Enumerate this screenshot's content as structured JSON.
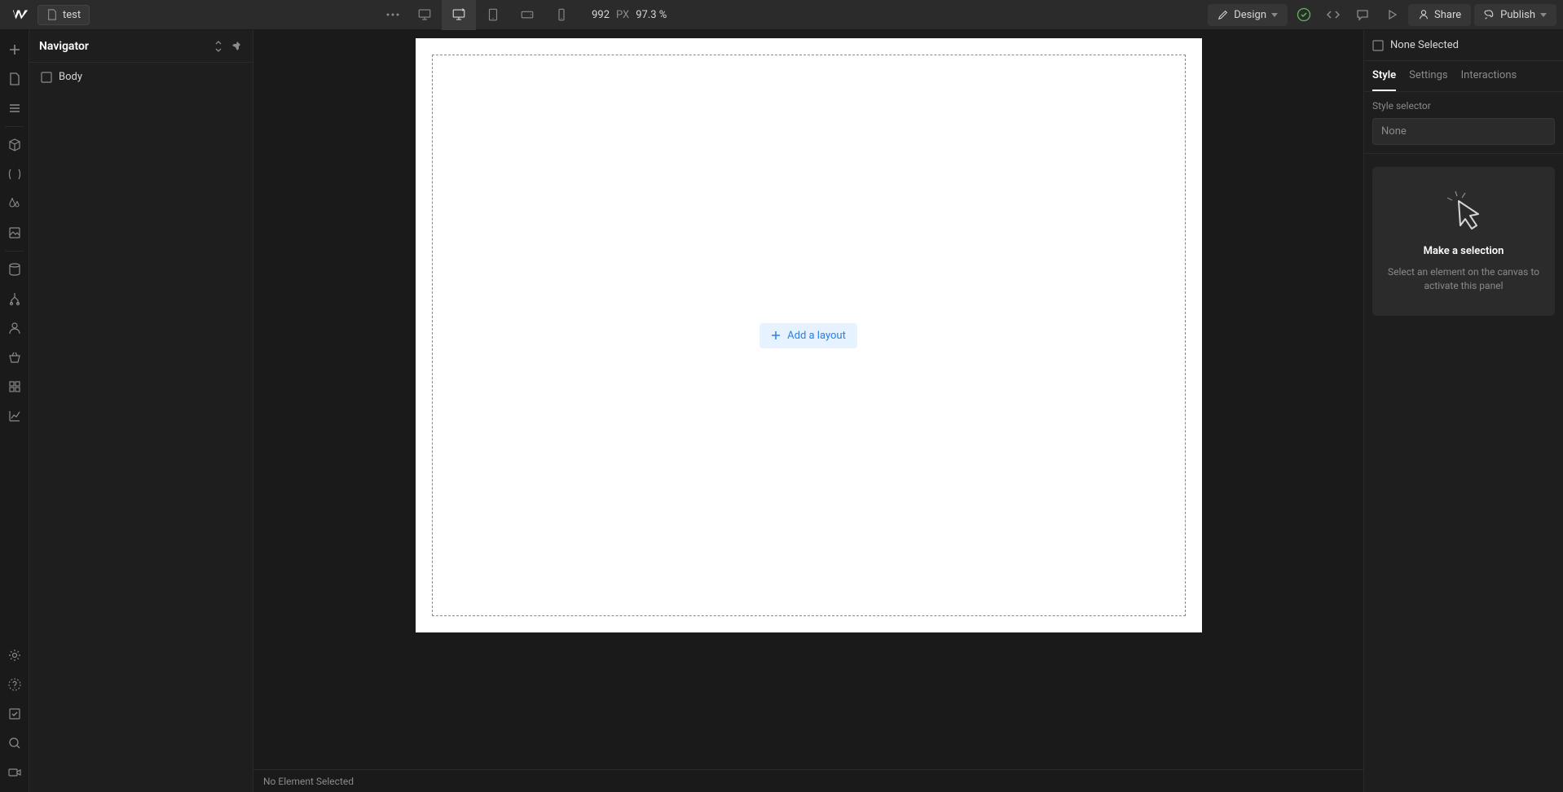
{
  "header": {
    "page_name": "test",
    "breakpoints": {
      "width_value": "992",
      "width_unit": "PX",
      "zoom": "97.3 %"
    },
    "mode_label": "Design",
    "share_label": "Share",
    "publish_label": "Publish"
  },
  "navigator": {
    "title": "Navigator",
    "tree": {
      "body_label": "Body"
    }
  },
  "canvas": {
    "add_layout_label": "Add a layout"
  },
  "status_bar": {
    "selection_text": "No Element Selected"
  },
  "right_panel": {
    "selected_label": "None Selected",
    "tabs": {
      "style": "Style",
      "settings": "Settings",
      "interactions": "Interactions"
    },
    "style_selector_label": "Style selector",
    "style_selector_value": "None",
    "empty": {
      "title": "Make a selection",
      "desc": "Select an element on the canvas to activate this panel"
    }
  }
}
